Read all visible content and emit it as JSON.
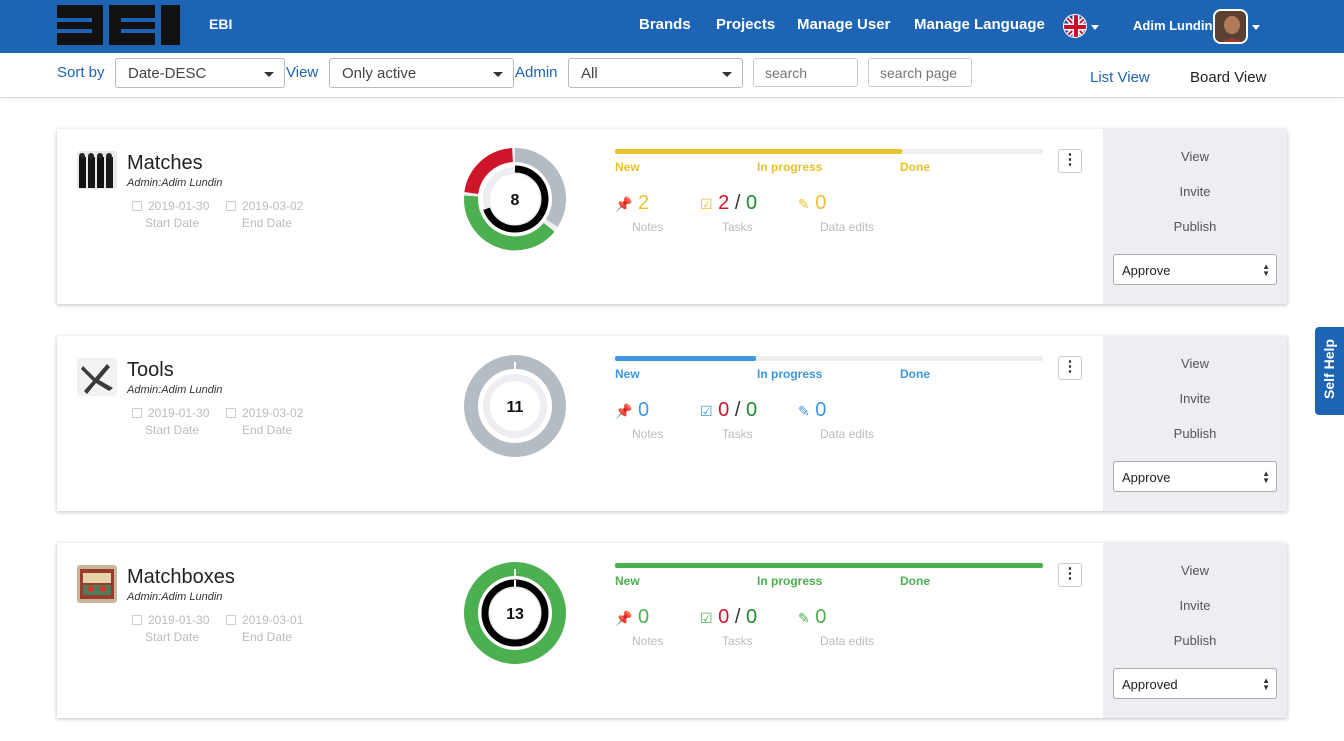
{
  "header": {
    "brand": "EBI",
    "nav": [
      "Brands",
      "Projects",
      "Manage User",
      "Manage Language"
    ],
    "user_name": "Adim Lundin"
  },
  "filters": {
    "sort_label": "Sort by",
    "sort_value": "Date-DESC",
    "view_label": "View",
    "view_value": "Only active",
    "admin_label": "Admin",
    "admin_value": "All",
    "search_placeholder": "search",
    "search_page_placeholder": "search page",
    "list_view": "List View",
    "board_view": "Board View"
  },
  "projects": [
    {
      "title": "Matches",
      "admin": "Admin:Adim Lundin",
      "start_date": "2019-01-30",
      "end_date": "2019-03-02",
      "start_label": "Start Date",
      "end_label": "End Date",
      "count": "8",
      "progress": 0.67,
      "status_color": "#e8c22c",
      "states": [
        "New",
        "In progress",
        "Done"
      ],
      "notes": "2",
      "notes_label": "Notes",
      "tasks_open": "2",
      "tasks_sep": "/",
      "tasks_done": "0",
      "tasks_label": "Tasks",
      "data_edits": "0",
      "data_edits_label": "Data edits",
      "actions": [
        "View",
        "Invite",
        "Publish"
      ],
      "approve": "Approve"
    },
    {
      "title": "Tools",
      "admin": "Admin:Adim Lundin",
      "start_date": "2019-01-30",
      "end_date": "2019-03-02",
      "start_label": "Start Date",
      "end_label": "End Date",
      "count": "11",
      "progress": 0.33,
      "status_color": "#3d97e0",
      "states": [
        "New",
        "In progress",
        "Done"
      ],
      "notes": "0",
      "notes_label": "Notes",
      "tasks_open": "0",
      "tasks_sep": "/",
      "tasks_done": "0",
      "tasks_label": "Tasks",
      "data_edits": "0",
      "data_edits_label": "Data edits",
      "actions": [
        "View",
        "Invite",
        "Publish"
      ],
      "approve": "Approve"
    },
    {
      "title": "Matchboxes",
      "admin": "Admin:Adim Lundin",
      "start_date": "2019-01-30",
      "end_date": "2019-03-01",
      "start_label": "Start Date",
      "end_label": "End Date",
      "count": "13",
      "progress": 1.0,
      "status_color": "#4caf50",
      "states": [
        "New",
        "In progress",
        "Done"
      ],
      "notes": "0",
      "notes_label": "Notes",
      "tasks_open": "0",
      "tasks_sep": "/",
      "tasks_done": "0",
      "tasks_label": "Tasks",
      "data_edits": "0",
      "data_edits_label": "Data edits",
      "actions": [
        "View",
        "Invite",
        "Publish"
      ],
      "approve": "Approved"
    }
  ],
  "self_help": "Self Help",
  "colors": {
    "header": "#1d64b5",
    "red": "#d0152a",
    "green": "#1e8a2e",
    "gray": "#b4bcc3"
  }
}
